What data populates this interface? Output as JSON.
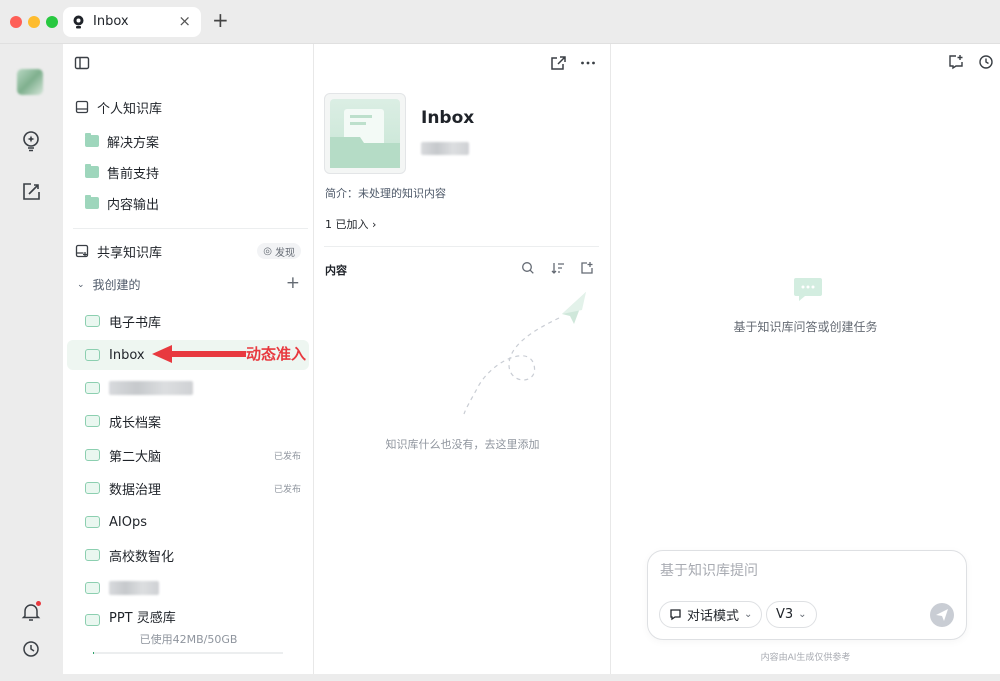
{
  "tab": {
    "title": "Inbox",
    "close": "×",
    "new": "+"
  },
  "sidebar": {
    "personal_kb": "个人知识库",
    "folders": [
      "解决方案",
      "售前支持",
      "内容输出"
    ],
    "shared_kb": "共享知识库",
    "discover": "发现",
    "my_created": "我创建的",
    "items": [
      {
        "label": "电子书库",
        "badge": ""
      },
      {
        "label": "Inbox",
        "badge": ""
      },
      {
        "label": "",
        "badge": ""
      },
      {
        "label": "成长档案",
        "badge": ""
      },
      {
        "label": "第二大脑",
        "badge": "已发布"
      },
      {
        "label": "数据治理",
        "badge": "已发布"
      },
      {
        "label": "AIOps",
        "badge": ""
      },
      {
        "label": "高校数智化",
        "badge": ""
      },
      {
        "label": "",
        "badge": ""
      },
      {
        "label": "PPT 灵感库",
        "badge": ""
      }
    ],
    "storage": "已使用42MB/50GB",
    "storage_fraction": 0.0008
  },
  "annotation": {
    "text": "动态准入",
    "color": "#e8393f"
  },
  "middle": {
    "title": "Inbox",
    "intro": "简介：未处理的知识内容",
    "joined": "1 已加入 ›",
    "content_header": "内容",
    "empty_text": "知识库什么也没有，去这里添加"
  },
  "right": {
    "hint": "基于知识库问答或创建任务",
    "input_placeholder": "基于知识库提问",
    "mode": "对话模式",
    "version": "V3",
    "disclaimer": "内容由AI生成仅供参考"
  },
  "colors": {
    "accent": "#2fa36b",
    "kb_icon": "#8ccfb0",
    "folder": "#9ed6bc",
    "alert": "#e8393f"
  }
}
